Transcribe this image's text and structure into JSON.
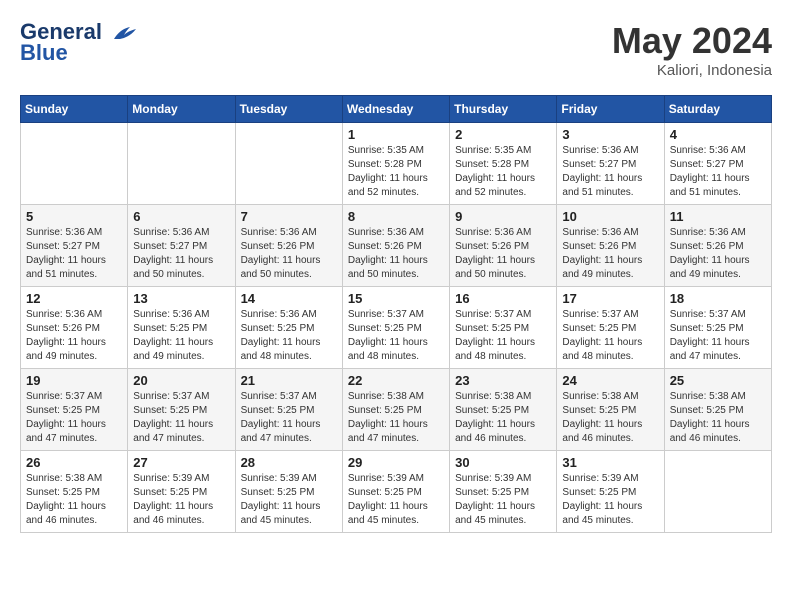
{
  "header": {
    "logo_line1": "General",
    "logo_line2": "Blue",
    "month_year": "May 2024",
    "location": "Kaliori, Indonesia"
  },
  "days_of_week": [
    "Sunday",
    "Monday",
    "Tuesday",
    "Wednesday",
    "Thursday",
    "Friday",
    "Saturday"
  ],
  "weeks": [
    [
      {
        "day": "",
        "info": ""
      },
      {
        "day": "",
        "info": ""
      },
      {
        "day": "",
        "info": ""
      },
      {
        "day": "1",
        "info": "Sunrise: 5:35 AM\nSunset: 5:28 PM\nDaylight: 11 hours\nand 52 minutes."
      },
      {
        "day": "2",
        "info": "Sunrise: 5:35 AM\nSunset: 5:28 PM\nDaylight: 11 hours\nand 52 minutes."
      },
      {
        "day": "3",
        "info": "Sunrise: 5:36 AM\nSunset: 5:27 PM\nDaylight: 11 hours\nand 51 minutes."
      },
      {
        "day": "4",
        "info": "Sunrise: 5:36 AM\nSunset: 5:27 PM\nDaylight: 11 hours\nand 51 minutes."
      }
    ],
    [
      {
        "day": "5",
        "info": "Sunrise: 5:36 AM\nSunset: 5:27 PM\nDaylight: 11 hours\nand 51 minutes."
      },
      {
        "day": "6",
        "info": "Sunrise: 5:36 AM\nSunset: 5:27 PM\nDaylight: 11 hours\nand 50 minutes."
      },
      {
        "day": "7",
        "info": "Sunrise: 5:36 AM\nSunset: 5:26 PM\nDaylight: 11 hours\nand 50 minutes."
      },
      {
        "day": "8",
        "info": "Sunrise: 5:36 AM\nSunset: 5:26 PM\nDaylight: 11 hours\nand 50 minutes."
      },
      {
        "day": "9",
        "info": "Sunrise: 5:36 AM\nSunset: 5:26 PM\nDaylight: 11 hours\nand 50 minutes."
      },
      {
        "day": "10",
        "info": "Sunrise: 5:36 AM\nSunset: 5:26 PM\nDaylight: 11 hours\nand 49 minutes."
      },
      {
        "day": "11",
        "info": "Sunrise: 5:36 AM\nSunset: 5:26 PM\nDaylight: 11 hours\nand 49 minutes."
      }
    ],
    [
      {
        "day": "12",
        "info": "Sunrise: 5:36 AM\nSunset: 5:26 PM\nDaylight: 11 hours\nand 49 minutes."
      },
      {
        "day": "13",
        "info": "Sunrise: 5:36 AM\nSunset: 5:25 PM\nDaylight: 11 hours\nand 49 minutes."
      },
      {
        "day": "14",
        "info": "Sunrise: 5:36 AM\nSunset: 5:25 PM\nDaylight: 11 hours\nand 48 minutes."
      },
      {
        "day": "15",
        "info": "Sunrise: 5:37 AM\nSunset: 5:25 PM\nDaylight: 11 hours\nand 48 minutes."
      },
      {
        "day": "16",
        "info": "Sunrise: 5:37 AM\nSunset: 5:25 PM\nDaylight: 11 hours\nand 48 minutes."
      },
      {
        "day": "17",
        "info": "Sunrise: 5:37 AM\nSunset: 5:25 PM\nDaylight: 11 hours\nand 48 minutes."
      },
      {
        "day": "18",
        "info": "Sunrise: 5:37 AM\nSunset: 5:25 PM\nDaylight: 11 hours\nand 47 minutes."
      }
    ],
    [
      {
        "day": "19",
        "info": "Sunrise: 5:37 AM\nSunset: 5:25 PM\nDaylight: 11 hours\nand 47 minutes."
      },
      {
        "day": "20",
        "info": "Sunrise: 5:37 AM\nSunset: 5:25 PM\nDaylight: 11 hours\nand 47 minutes."
      },
      {
        "day": "21",
        "info": "Sunrise: 5:37 AM\nSunset: 5:25 PM\nDaylight: 11 hours\nand 47 minutes."
      },
      {
        "day": "22",
        "info": "Sunrise: 5:38 AM\nSunset: 5:25 PM\nDaylight: 11 hours\nand 47 minutes."
      },
      {
        "day": "23",
        "info": "Sunrise: 5:38 AM\nSunset: 5:25 PM\nDaylight: 11 hours\nand 46 minutes."
      },
      {
        "day": "24",
        "info": "Sunrise: 5:38 AM\nSunset: 5:25 PM\nDaylight: 11 hours\nand 46 minutes."
      },
      {
        "day": "25",
        "info": "Sunrise: 5:38 AM\nSunset: 5:25 PM\nDaylight: 11 hours\nand 46 minutes."
      }
    ],
    [
      {
        "day": "26",
        "info": "Sunrise: 5:38 AM\nSunset: 5:25 PM\nDaylight: 11 hours\nand 46 minutes."
      },
      {
        "day": "27",
        "info": "Sunrise: 5:39 AM\nSunset: 5:25 PM\nDaylight: 11 hours\nand 46 minutes."
      },
      {
        "day": "28",
        "info": "Sunrise: 5:39 AM\nSunset: 5:25 PM\nDaylight: 11 hours\nand 45 minutes."
      },
      {
        "day": "29",
        "info": "Sunrise: 5:39 AM\nSunset: 5:25 PM\nDaylight: 11 hours\nand 45 minutes."
      },
      {
        "day": "30",
        "info": "Sunrise: 5:39 AM\nSunset: 5:25 PM\nDaylight: 11 hours\nand 45 minutes."
      },
      {
        "day": "31",
        "info": "Sunrise: 5:39 AM\nSunset: 5:25 PM\nDaylight: 11 hours\nand 45 minutes."
      },
      {
        "day": "",
        "info": ""
      }
    ]
  ]
}
